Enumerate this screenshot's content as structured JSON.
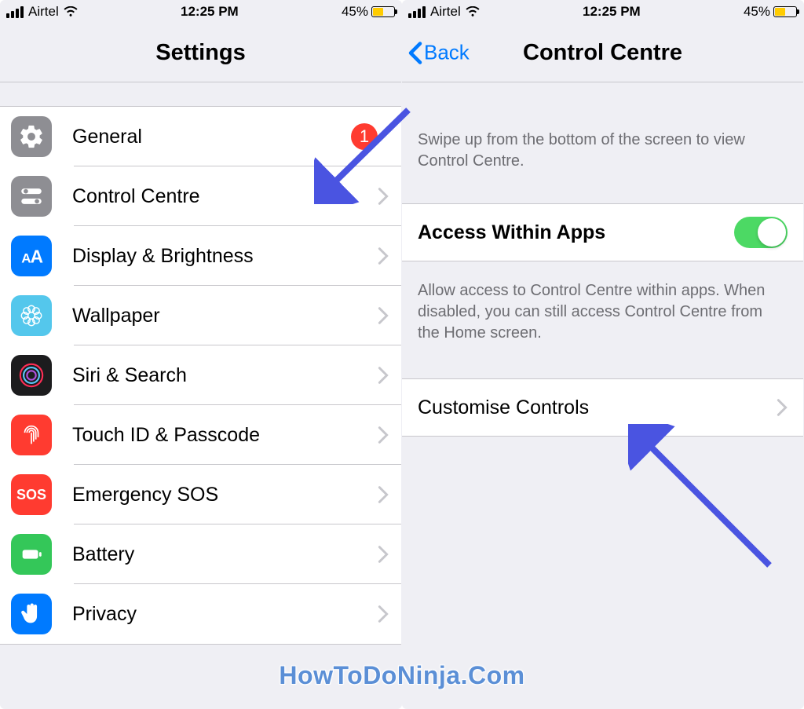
{
  "status": {
    "carrier": "Airtel",
    "time": "12:25 PM",
    "battery_pct": "45%"
  },
  "left": {
    "title": "Settings",
    "rows": [
      {
        "label": "General",
        "badge": "1"
      },
      {
        "label": "Control Centre"
      },
      {
        "label": "Display & Brightness"
      },
      {
        "label": "Wallpaper"
      },
      {
        "label": "Siri & Search"
      },
      {
        "label": "Touch ID & Passcode"
      },
      {
        "label": "Emergency SOS"
      },
      {
        "label": "Battery"
      },
      {
        "label": "Privacy"
      }
    ]
  },
  "right": {
    "back": "Back",
    "title": "Control Centre",
    "hint1": "Swipe up from the bottom of the screen to view Control Centre.",
    "access_label": "Access Within Apps",
    "hint2": "Allow access to Control Centre within apps. When disabled, you can still access Control Centre from the Home screen.",
    "customise_label": "Customise Controls"
  },
  "watermark": "HowToDoNinja.Com"
}
